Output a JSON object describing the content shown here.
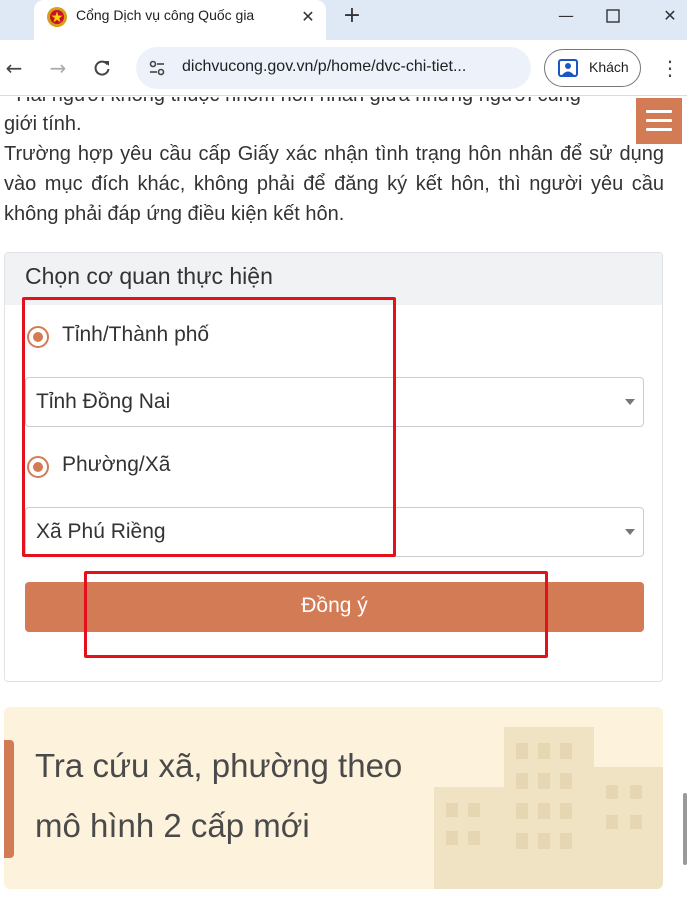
{
  "browser": {
    "tab_title": "Cổng Dịch vụ công Quốc gia",
    "url": "dichvucong.gov.vn/p/home/dvc-chi-tiet...",
    "profile_label": "Khách"
  },
  "content": {
    "cut_line": "- Hai người không thuộc nhóm hôn nhân giữa những người cùng",
    "para_line1": "giới tính.",
    "para_main": "Trường hợp yêu cầu cấp Giấy xác nhận tình trạng hôn nhân để sử dụng vào mục đích khác, không phải để đăng ký kết hôn, thì người yêu cầu không phải đáp ứng điều kiện kết hôn."
  },
  "panel": {
    "title": "Chọn cơ quan thực hiện",
    "province_label": "Tỉnh/Thành phố",
    "province_value": "Tỉnh Đồng Nai",
    "ward_label": "Phường/Xã",
    "ward_value": "Xã Phú Riềng",
    "submit_label": "Đồng ý"
  },
  "banner": {
    "line1": "Tra cứu xã, phường theo",
    "line2": "mô hình 2 cấp mới"
  },
  "colors": {
    "accent": "#d37b55",
    "highlight_box": "#e3111b",
    "banner_bg": "#fdf3dc"
  }
}
